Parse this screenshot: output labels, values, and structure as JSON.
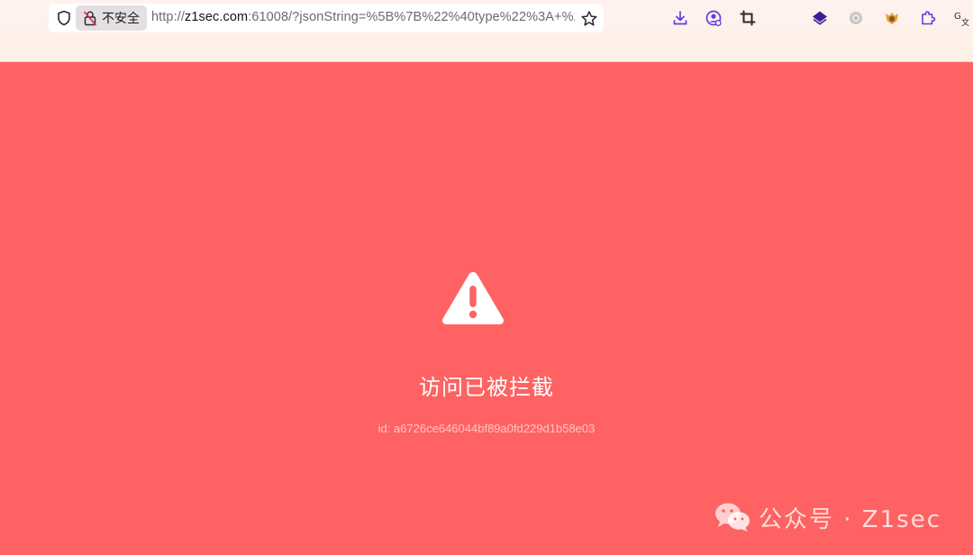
{
  "browser": {
    "security_label": "不安全",
    "url_prefix": "http://",
    "url_host": "z1sec.com",
    "url_rest": ":61008/?jsonString=%5B%7B%22%40type%22%3A+%2",
    "icons": [
      "shield-icon",
      "insecure-lock-icon",
      "bookmark-star-icon",
      "download-icon",
      "account-icon",
      "screenshot-crop-icon",
      "extension-layers-icon",
      "extension-gray-icon",
      "extension-fox-icon",
      "extensions-puzzle-icon",
      "translate-icon"
    ]
  },
  "block_page": {
    "title": "访问已被拦截",
    "id_text": "id: a6726ce646044bf89a0fd229d1b58e03",
    "background_color": "#ff6262"
  },
  "watermark": {
    "text": "公众号 · Z1sec"
  }
}
